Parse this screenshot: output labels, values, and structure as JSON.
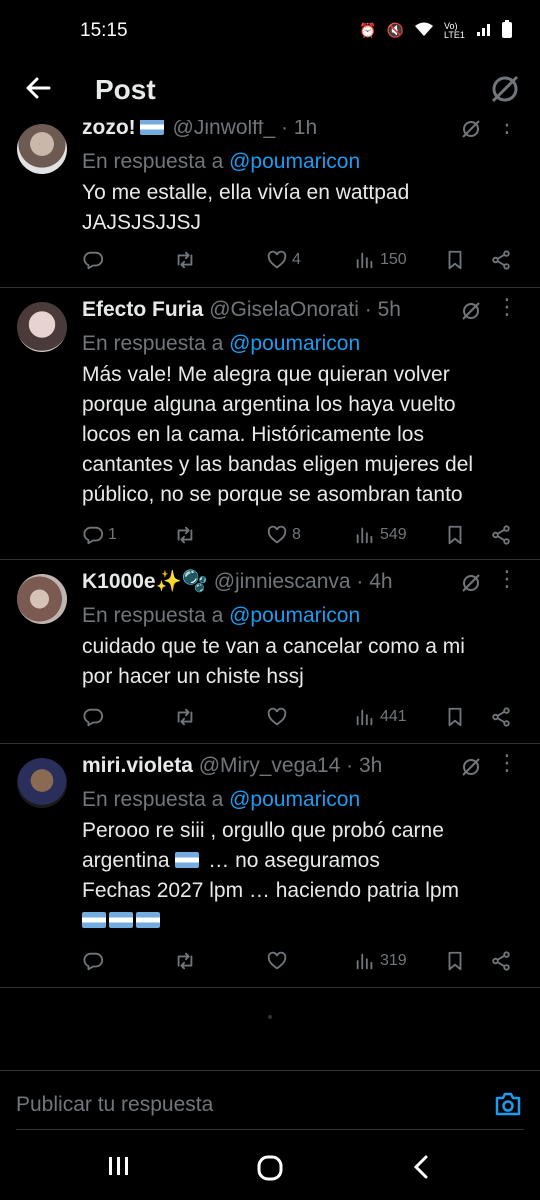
{
  "status_bar": {
    "time": "15:15",
    "network": "Vo) LTE1"
  },
  "header": {
    "title": "Post"
  },
  "tweets": [
    {
      "name": "zozo!",
      "handle": "@Jinwolff_ · 1h",
      "reply_prefix": "En respuesta a",
      "reply_to": "@poumaricon",
      "text_lines": [
        "Yo me estalle, ella vivía en wattpad",
        "JAJSJSJJSJ"
      ],
      "replies": "",
      "reposts": "",
      "likes": "4",
      "views": "150"
    },
    {
      "name": "Efecto Furia",
      "handle": "@GiselaOnorati · 5h",
      "reply_prefix": "En respuesta a",
      "reply_to": "@poumaricon",
      "text_lines": [
        "Más vale! Me alegra que quieran volver",
        "porque alguna argentina los haya vuelto",
        "locos en la cama. Históricamente los",
        "cantantes y las bandas eligen mujeres del",
        "público, no se porque se asombran tanto"
      ],
      "replies": "1",
      "reposts": "",
      "likes": "8",
      "views": "549"
    },
    {
      "name": "K1000e✨🫧",
      "handle": "@jinniescanva · 4h",
      "reply_prefix": "En respuesta a",
      "reply_to": "@poumaricon",
      "text_lines": [
        "cuidado que te van a cancelar como a mi",
        "por hacer un chiste hssj"
      ],
      "replies": "",
      "reposts": "",
      "likes": "",
      "views": "441"
    },
    {
      "name": "miri.violeta",
      "handle": "@Miry_vega14 · 3h",
      "reply_prefix": "En respuesta a",
      "reply_to": "@poumaricon",
      "text_lines": [
        "Perooo re siii , orgullo que probó carne",
        "argentina … no aseguramos",
        "Fechas 2027 lpm … haciendo patria lpm",
        ""
      ],
      "replies": "",
      "reposts": "",
      "likes": "",
      "views": "319"
    }
  ],
  "compose": {
    "placeholder": "Publicar tu respuesta"
  },
  "colors": {
    "accent": "#1d9bf0",
    "muted": "#71767b",
    "text": "#e7e9ea",
    "divider": "#2f3336",
    "background": "#000000"
  }
}
